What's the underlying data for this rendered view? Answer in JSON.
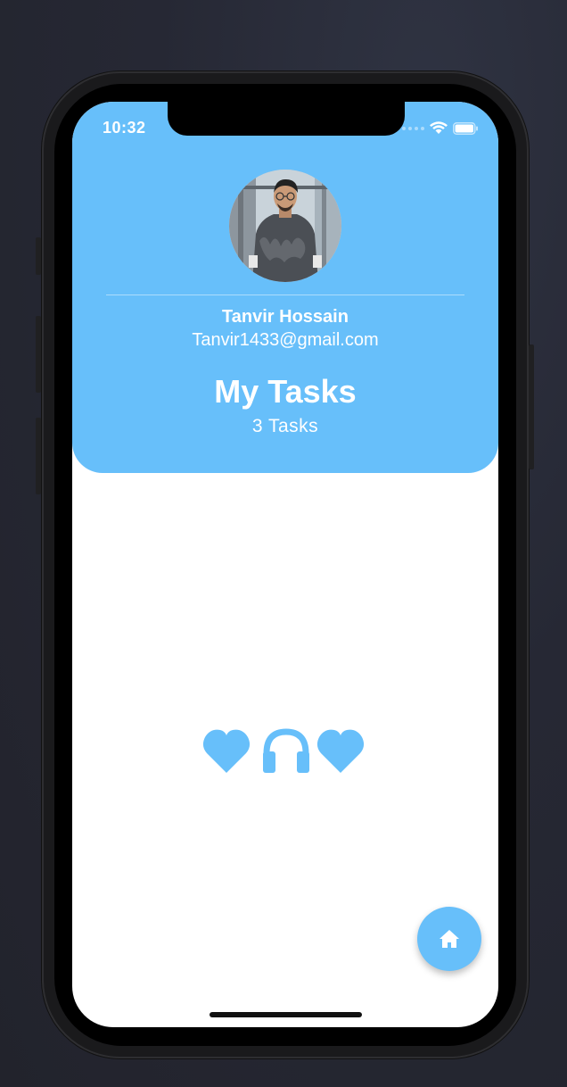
{
  "status_bar": {
    "time": "10:32",
    "icons": [
      "signal-dots",
      "wifi-icon",
      "battery-icon"
    ]
  },
  "profile": {
    "avatar": "avatar-photo",
    "name": "Tanvir Hossain",
    "email": "Tanvir1433@gmail.com"
  },
  "tasks_header": {
    "title": "My Tasks",
    "count_label": "3 Tasks"
  },
  "empty_state_icons": [
    "heart-icon",
    "headphones-icon",
    "heart-icon"
  ],
  "fab": {
    "icon": "home-icon"
  },
  "colors": {
    "accent": "#67bffa",
    "background": "#ffffff",
    "backdrop": "#262834"
  }
}
